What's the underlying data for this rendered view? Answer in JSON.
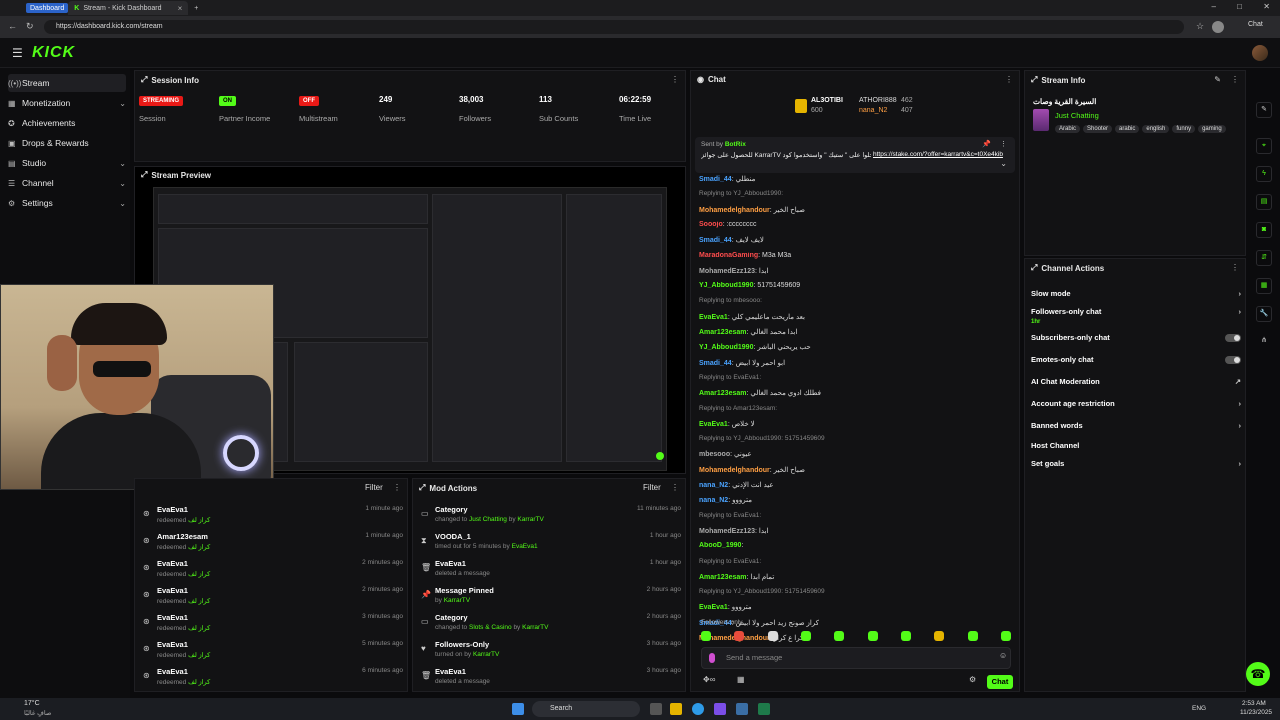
{
  "browser": {
    "tab_badge": "Dashboard",
    "tab_title": "Stream - Kick Dashboard",
    "new_tab": "+",
    "url": "https://dashboard.kick.com/stream",
    "chat_btn": "Chat"
  },
  "header": {
    "logo": "KICK"
  },
  "sidebar": {
    "items": [
      {
        "label": "Stream"
      },
      {
        "label": "Monetization"
      },
      {
        "label": "Achievements"
      },
      {
        "label": "Drops & Rewards"
      },
      {
        "label": "Studio"
      },
      {
        "label": "Channel"
      },
      {
        "label": "Settings"
      }
    ]
  },
  "session": {
    "title": "Session Info",
    "stats": [
      {
        "value": "STREAMING",
        "label": "Session",
        "color": "#e91916"
      },
      {
        "value": "ON",
        "label": "Partner Income",
        "color": "#53fc18"
      },
      {
        "value": "OFF",
        "label": "Multistream",
        "color": "#e91916"
      },
      {
        "value": "249",
        "label": "Viewers"
      },
      {
        "value": "38,003",
        "label": "Followers"
      },
      {
        "value": "113",
        "label": "Sub Counts"
      },
      {
        "value": "06:22:59",
        "label": "Time Live"
      }
    ]
  },
  "preview": {
    "title": "Stream Preview"
  },
  "activity": {
    "filter": "Filter",
    "rows": [
      {
        "name": "EvaEva1",
        "action": "redeemed",
        "reward": "كراز لف",
        "time": "1 minute ago"
      },
      {
        "name": "Amar123esam",
        "action": "redeemed",
        "reward": "كراز لف",
        "time": "1 minute ago"
      },
      {
        "name": "EvaEva1",
        "action": "redeemed",
        "reward": "كراز لف",
        "time": "2 minutes ago"
      },
      {
        "name": "EvaEva1",
        "action": "redeemed",
        "reward": "كراز لف",
        "time": "2 minutes ago"
      },
      {
        "name": "EvaEva1",
        "action": "redeemed",
        "reward": "كراز لف",
        "time": "3 minutes ago"
      },
      {
        "name": "EvaEva1",
        "action": "redeemed",
        "reward": "كراز لف",
        "time": "5 minutes ago"
      },
      {
        "name": "EvaEva1",
        "action": "redeemed",
        "reward": "كراز لف",
        "time": "6 minutes ago"
      }
    ]
  },
  "mod": {
    "title": "Mod Actions",
    "filter": "Filter",
    "rows": [
      {
        "name": "Category",
        "desc": "changed to",
        "target": "Just Chatting",
        "by": "by",
        "user": "KarrarTV",
        "time": "11 minutes ago"
      },
      {
        "name": "VOODA_1",
        "desc": "timed out for 5 minutes by",
        "target": "",
        "by": "",
        "user": "EvaEva1",
        "time": "1 hour ago"
      },
      {
        "name": "EvaEva1",
        "desc": "deleted a message",
        "target": "",
        "by": "",
        "user": "",
        "time": "1 hour ago"
      },
      {
        "name": "Message Pinned",
        "desc": "by",
        "target": "",
        "by": "",
        "user": "KarrarTV",
        "time": "2 hours ago"
      },
      {
        "name": "Category",
        "desc": "changed to",
        "target": "Slots & Casino",
        "by": "by",
        "user": "KarrarTV",
        "time": "2 hours ago"
      },
      {
        "name": "Followers-Only",
        "desc": "turned on by",
        "target": "",
        "by": "",
        "user": "KarrarTV",
        "time": "3 hours ago"
      },
      {
        "name": "EvaEva1",
        "desc": "deleted a message",
        "target": "",
        "by": "",
        "user": "",
        "time": "3 hours ago"
      }
    ]
  },
  "chat": {
    "title": "Chat",
    "leaders": [
      {
        "name": "AL3OTIBI",
        "score": "600"
      },
      {
        "name": "ATHORI888",
        "score": "462"
      },
      {
        "name": "nana_N2",
        "score": "407"
      }
    ],
    "pinned_sent_by": "Sent by",
    "pinned_user": "BotRix",
    "pinned_text": "للحصول على جوائز KarrarTV سجلوا على \" ستيك \" واستخدموا كود",
    "pinned_link": "https://stake.com/?offer=karrartv&c=t0Xe4kib",
    "messages": [
      {
        "user": "Smadi_44",
        "text": "منطلي",
        "color": "#4aa3ff",
        "reply": ""
      },
      {
        "user": "",
        "text": "Replying to YJ_Abboud1990:",
        "color": "#888",
        "reply": "yes"
      },
      {
        "user": "Mohamedelghandour",
        "text": "صباح الخير",
        "color": "#ff9f43",
        "reply": ""
      },
      {
        "user": "Sooojo",
        "text": ":cccccccc",
        "color": "#ff4d4d",
        "reply": ""
      },
      {
        "user": "Smadi_44",
        "text": "لايف لايف",
        "color": "#4aa3ff",
        "reply": ""
      },
      {
        "user": "MaradonaGaming",
        "text": "M3a M3a",
        "color": "#ff4d4d",
        "reply": ""
      },
      {
        "user": "MohamedEzz123",
        "text": "ابدا",
        "color": "#aaaaaa",
        "reply": ""
      },
      {
        "user": "YJ_Abboud1990",
        "text": "51751459609",
        "color": "#53fc18",
        "reply": ""
      },
      {
        "user": "",
        "text": "Replying to mbesooo:",
        "color": "#888",
        "reply": "yes"
      },
      {
        "user": "EvaEva1",
        "text": "بعد ماريحت ماعليمي كلي",
        "color": "#53fc18",
        "reply": ""
      },
      {
        "user": "Amar123esam",
        "text": "ابدا محمد الغالي",
        "color": "#53fc18",
        "reply": ""
      },
      {
        "user": "YJ_Abboud1990",
        "text": "حب يريحني الباشر",
        "color": "#53fc18",
        "reply": ""
      },
      {
        "user": "Smadi_44",
        "text": "ابو احمر ولا ابيض",
        "color": "#4aa3ff",
        "reply": ""
      },
      {
        "user": "",
        "text": "Replying to EvaEva1:",
        "color": "#888",
        "reply": "yes"
      },
      {
        "user": "Amar123esam",
        "text": "فطلك ادوي محمد الغالي",
        "color": "#53fc18",
        "reply": ""
      },
      {
        "user": "",
        "text": "Replying to Amar123esam:",
        "color": "#888",
        "reply": "yes"
      },
      {
        "user": "EvaEva1",
        "text": "لا خلاص",
        "color": "#53fc18",
        "reply": ""
      },
      {
        "user": "",
        "text": "Replying to YJ_Abboud1990: 51751459609",
        "color": "#888",
        "reply": "yes"
      },
      {
        "user": "mbesooo",
        "text": "عيوني",
        "color": "#aaaaaa",
        "reply": ""
      },
      {
        "user": "Mohamedelghandour",
        "text": "صباح الخير",
        "color": "#ff9f43",
        "reply": ""
      },
      {
        "user": "nana_N2",
        "text": "عيد انت الإدني",
        "color": "#4aa3ff",
        "reply": ""
      },
      {
        "user": "nana_N2",
        "text": "مترووو",
        "color": "#4aa3ff",
        "reply": ""
      },
      {
        "user": "",
        "text": "Replying to EvaEva1:",
        "color": "#888",
        "reply": "yes"
      },
      {
        "user": "MohamedEzz123",
        "text": "ابدا",
        "color": "#aaaaaa",
        "reply": ""
      },
      {
        "user": "AbooD_1990",
        "text": "",
        "color": "#53fc18",
        "reply": ""
      },
      {
        "user": "",
        "text": "Replying to EvaEva1:",
        "color": "#888",
        "reply": "yes"
      },
      {
        "user": "Amar123esam",
        "text": "تمام ابدا",
        "color": "#53fc18",
        "reply": ""
      },
      {
        "user": "",
        "text": "Replying to YJ_Abboud1990: 51751459609",
        "color": "#888",
        "reply": "yes"
      },
      {
        "user": "EvaEva1",
        "text": "مترووو",
        "color": "#53fc18",
        "reply": ""
      },
      {
        "user": "Smadi_44",
        "text": "كراز صونج زيد احمر ولا ابيض",
        "color": "#4aa3ff",
        "reply": ""
      },
      {
        "user": "Mohamedelghandour",
        "text": "شكرا ع كراز",
        "color": "#ff9f43",
        "reply": ""
      }
    ],
    "followers_only": "Followers only",
    "placeholder": "Send a message",
    "send": "Chat"
  },
  "stream_info": {
    "title": "Stream Info",
    "stream_title": "السيرة القرية وصات",
    "category": "Just Chatting",
    "tags": [
      "Arabic",
      "Shooter",
      "arabic",
      "english",
      "funny",
      "gaming"
    ]
  },
  "channel_actions": {
    "title": "Channel Actions",
    "items": [
      {
        "label": "Slow mode",
        "kind": "chev"
      },
      {
        "label": "Followers-only chat",
        "sub": "1hr",
        "kind": "chev"
      },
      {
        "label": "Subscribers-only chat",
        "kind": "toggle"
      },
      {
        "label": "Emotes-only chat",
        "kind": "toggle"
      },
      {
        "label": "AI Chat Moderation",
        "kind": "ext"
      },
      {
        "label": "Account age restriction",
        "kind": "chev"
      },
      {
        "label": "Banned words",
        "kind": "chev"
      },
      {
        "label": "Host Channel",
        "kind": "none"
      },
      {
        "label": "Set goals",
        "kind": "chev"
      }
    ]
  },
  "taskbar": {
    "weather_temp": "17°C",
    "weather_text": "صافٍ غالبًا",
    "search": "Search",
    "lang": "ENG",
    "time": "2:53 AM",
    "date": "11/23/2025"
  },
  "colors": {
    "brand": "#53fc18",
    "live": "#e91916"
  }
}
